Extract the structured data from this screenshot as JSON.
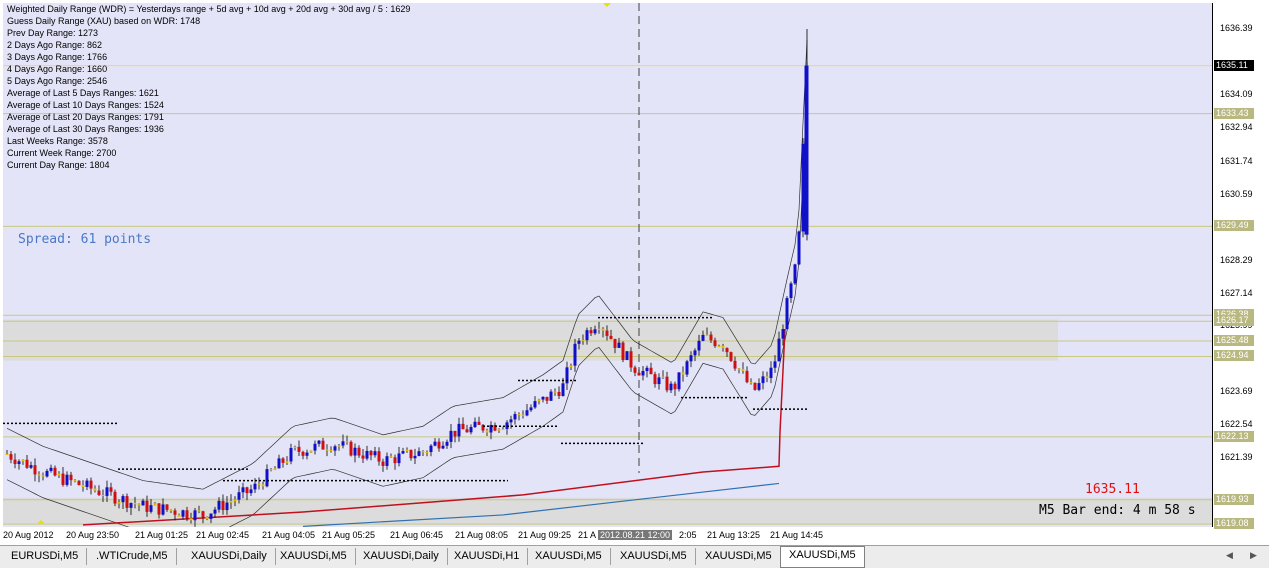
{
  "info": {
    "lines": [
      "Weighted Daily Range (WDR) = Yesterdays range + 5d avg + 10d avg + 20d avg + 30d avg / 5 : 1629",
      "Guess Daily Range (XAU) based on WDR: 1748",
      "Prev Day Range: 1273",
      "2 Days Ago Range: 862",
      "3 Days Ago Range: 1766",
      "4 Days Ago Range: 1660",
      "5 Days Ago Range: 2546",
      "Average of Last 5 Days Ranges: 1621",
      "Average of Last 10 Days Ranges: 1524",
      "Average of Last 20 Days Ranges: 1791",
      "Average of Last 30 Days Ranges: 1936",
      "Last Weeks Range: 3578",
      "Current Week Range: 2700",
      "Current Day Range: 1804"
    ],
    "spread": "Spread: 61 points",
    "current_price_red": "1635.11",
    "bar_end": "M5 Bar end: 4 m 58 s"
  },
  "price_axis": {
    "labels": [
      "1636.39",
      "1634.09",
      "1632.94",
      "1631.74",
      "1630.59",
      "1628.29",
      "1627.14",
      "1625.99",
      "1623.69",
      "1622.54",
      "1621.39"
    ],
    "tags": [
      "1635.11",
      "1633.43",
      "1629.49",
      "1626.38",
      "1626.17",
      "1625.48",
      "1624.94",
      "1622.13",
      "1619.93",
      "1619.08"
    ],
    "current": "1635.11"
  },
  "time_axis": {
    "labels": [
      "20 Aug 2012",
      "20 Aug 23:50",
      "21 Aug 01:25",
      "21 Aug 02:45",
      "21 Aug 04:05",
      "21 Aug 05:25",
      "21 Aug 06:45",
      "21 Aug 08:05",
      "21 Aug 09:25",
      "21 A",
      "2:05",
      "21 Aug 13:25",
      "21 Aug 14:45"
    ],
    "cursor_label": "2012.08.21 12:00"
  },
  "tabs": [
    "EURUSDi,M5",
    ".WTICrude,M5",
    "XAUUSDi,Daily",
    "XAUUSDi,M5",
    "XAUUSDi,Daily",
    "XAUUSDi,H1",
    "XAUUSDi,M5",
    "XAUUSDi,M5",
    "XAUUSDi,M5",
    "XAUUSDi,M5"
  ],
  "active_tab": 9,
  "colors": {
    "plot_bg": "#e4e4f8",
    "bull": "#1010c8",
    "bear": "#d01010",
    "doji": "#e8c000",
    "level_line": "#c8c880"
  }
}
